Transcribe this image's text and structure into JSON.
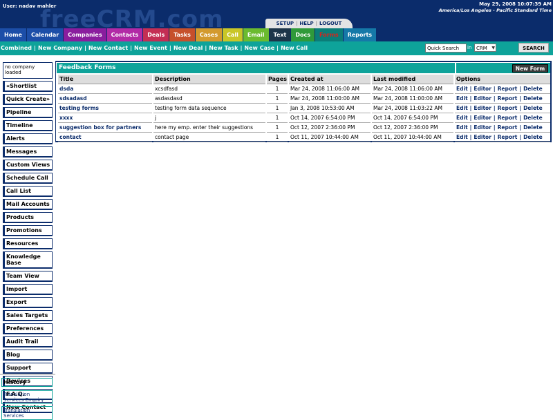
{
  "header": {
    "user_label": "User: nadav mahler",
    "logo_text": "freeCRM.com",
    "datetime": "May 29, 2008 10:07:39 AM",
    "timezone": "America/Los Angeles - Pacific Standard Time",
    "utility_links": [
      "SETUP",
      "HELP",
      "LOGOUT"
    ]
  },
  "main_tabs": [
    {
      "label": "Home",
      "color": "#1c4ea8"
    },
    {
      "label": "Calendar",
      "color": "#1c4ea8"
    },
    {
      "label": "Companies",
      "color": "#8a1d9e"
    },
    {
      "label": "Contacts",
      "color": "#b22aa6"
    },
    {
      "label": "Deals",
      "color": "#c42e54"
    },
    {
      "label": "Tasks",
      "color": "#c6502b"
    },
    {
      "label": "Cases",
      "color": "#d39a2e"
    },
    {
      "label": "Call",
      "color": "#c9c627"
    },
    {
      "label": "Email",
      "color": "#6bbb2f"
    },
    {
      "label": "Text",
      "color": "#1d3549"
    },
    {
      "label": "Docs",
      "color": "#2f9a3a"
    },
    {
      "label": "Forms",
      "color": "#0b7d78",
      "text_color": "#e0201a"
    },
    {
      "label": "Reports",
      "color": "#1579a8"
    }
  ],
  "quick_links": [
    "Combined",
    "New Company",
    "New Contact",
    "New Event",
    "New Deal",
    "New Task",
    "New Case",
    "New Call"
  ],
  "search": {
    "value": "Quick Search",
    "in_label": "in",
    "scope": "CRM",
    "button": "SEARCH"
  },
  "sidebar": {
    "company_box": "no company loaded",
    "items": [
      "«Shortlist",
      "Quick Create»",
      "Pipeline",
      "Timeline",
      "Alerts",
      "Messages",
      "Custom Views",
      "Schedule Call",
      "Call List",
      "Mail Accounts",
      "Products",
      "Promotions",
      "Resources",
      "Knowledge Base",
      "Team View",
      "Import",
      "Export",
      "Sales Targets",
      "Preferences",
      "Audit Trail",
      "Blog",
      "Support",
      "Devices",
      "F.A.Q.",
      "New Contact"
    ],
    "history_header": "History",
    "history_items": [
      "Translation Services Enquiry",
      "Translation Services"
    ]
  },
  "panel": {
    "title": "Feedback Forms",
    "new_form_button": "New Form",
    "columns": [
      "Title",
      "Description",
      "Pages",
      "Created at",
      "Last modified",
      "Options"
    ],
    "option_labels": [
      "Edit",
      "Editor",
      "Report",
      "Delete"
    ],
    "rows": [
      {
        "title": "dsda",
        "description": "xcsdfasd",
        "pages": "1",
        "created": "Mar 24, 2008 11:06:00 AM",
        "modified": "Mar 24, 2008 11:06:00 AM"
      },
      {
        "title": "sdsadasd",
        "description": "asdasdasd",
        "pages": "1",
        "created": "Mar 24, 2008 11:00:00 AM",
        "modified": "Mar 24, 2008 11:00:00 AM"
      },
      {
        "title": "testing forms",
        "description": "testing form data sequence",
        "pages": "1",
        "created": "Jan 3, 2008 10:53:00 AM",
        "modified": "Mar 24, 2008 11:03:22 AM"
      },
      {
        "title": "xxxx",
        "description": "j",
        "pages": "1",
        "created": "Oct 14, 2007 6:54:00 PM",
        "modified": "Oct 14, 2007 6:54:00 PM"
      },
      {
        "title": "suggestion box for partners",
        "description": "here my emp. enter their suggestions",
        "pages": "1",
        "created": "Oct 12, 2007 2:36:00 PM",
        "modified": "Oct 12, 2007 2:36:00 PM"
      },
      {
        "title": "contact",
        "description": "contact page",
        "pages": "1",
        "created": "Oct 11, 2007 10:44:00 AM",
        "modified": "Oct 11, 2007 10:44:00 AM"
      }
    ]
  }
}
